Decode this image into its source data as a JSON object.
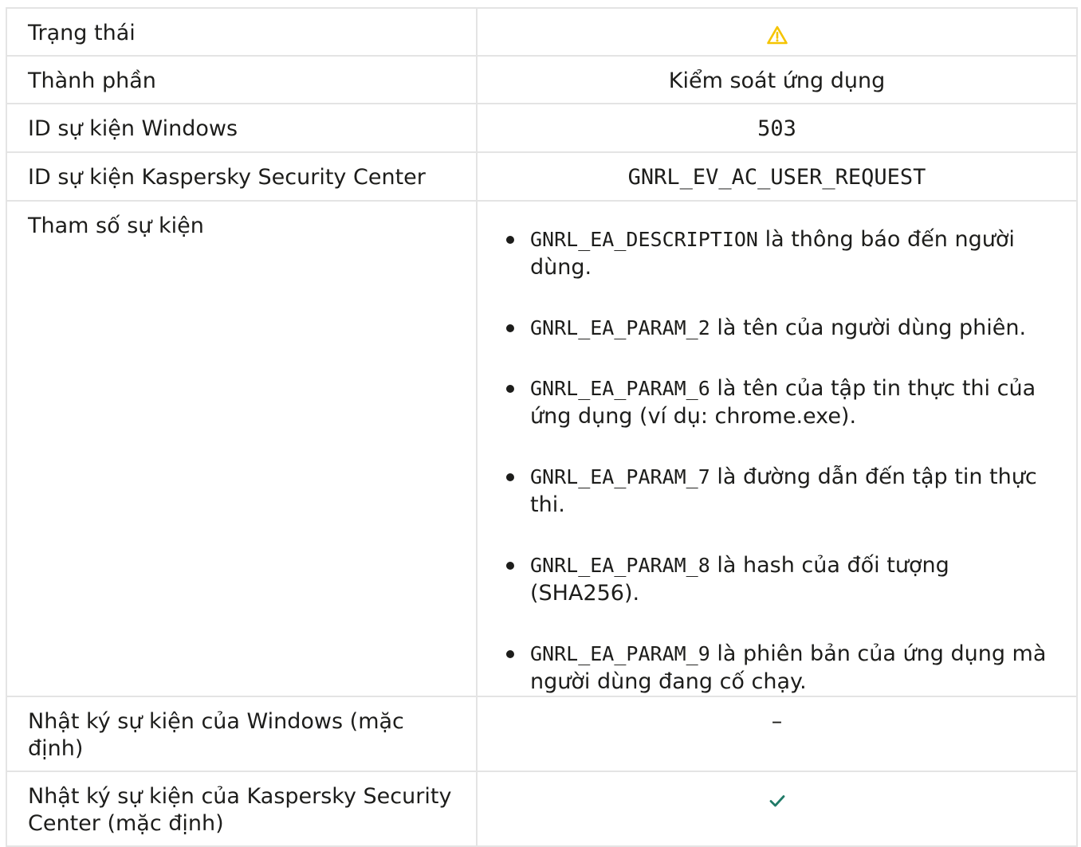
{
  "rows": [
    {
      "label": "Trạng thái",
      "icon": "warning-icon",
      "icon_color": "#f5c400"
    },
    {
      "label": "Thành phần",
      "value": "Kiểm soát ứng dụng"
    },
    {
      "label": "ID sự kiện Windows",
      "value": "503"
    },
    {
      "label": "ID sự kiện Kaspersky Security Center",
      "value": "GNRL_EV_AC_USER_REQUEST"
    },
    {
      "label": "Tham số sự kiện",
      "params": [
        {
          "code": "GNRL_EA_DESCRIPTION",
          "text": " là thông báo đến người dùng."
        },
        {
          "code": "GNRL_EA_PARAM_2",
          "text": " là tên của người dùng phiên."
        },
        {
          "code": "GNRL_EA_PARAM_6",
          "text": " là tên của tập tin thực thi của ứng dụng (ví dụ: chrome.exe)."
        },
        {
          "code": "GNRL_EA_PARAM_7",
          "text": " là đường dẫn đến tập tin thực thi."
        },
        {
          "code": "GNRL_EA_PARAM_8",
          "text": " là hash của đối tượng (SHA256)."
        },
        {
          "code": "GNRL_EA_PARAM_9",
          "text": " là phiên bản của ứng dụng mà người dùng đang cố chạy."
        }
      ]
    },
    {
      "label": "Nhật ký sự kiện của Windows (mặc định)",
      "value": "–"
    },
    {
      "label": "Nhật ký sự kiện của Kaspersky Security Center (mặc định)",
      "icon": "checkmark-icon",
      "icon_color": "#1f7a67"
    }
  ]
}
